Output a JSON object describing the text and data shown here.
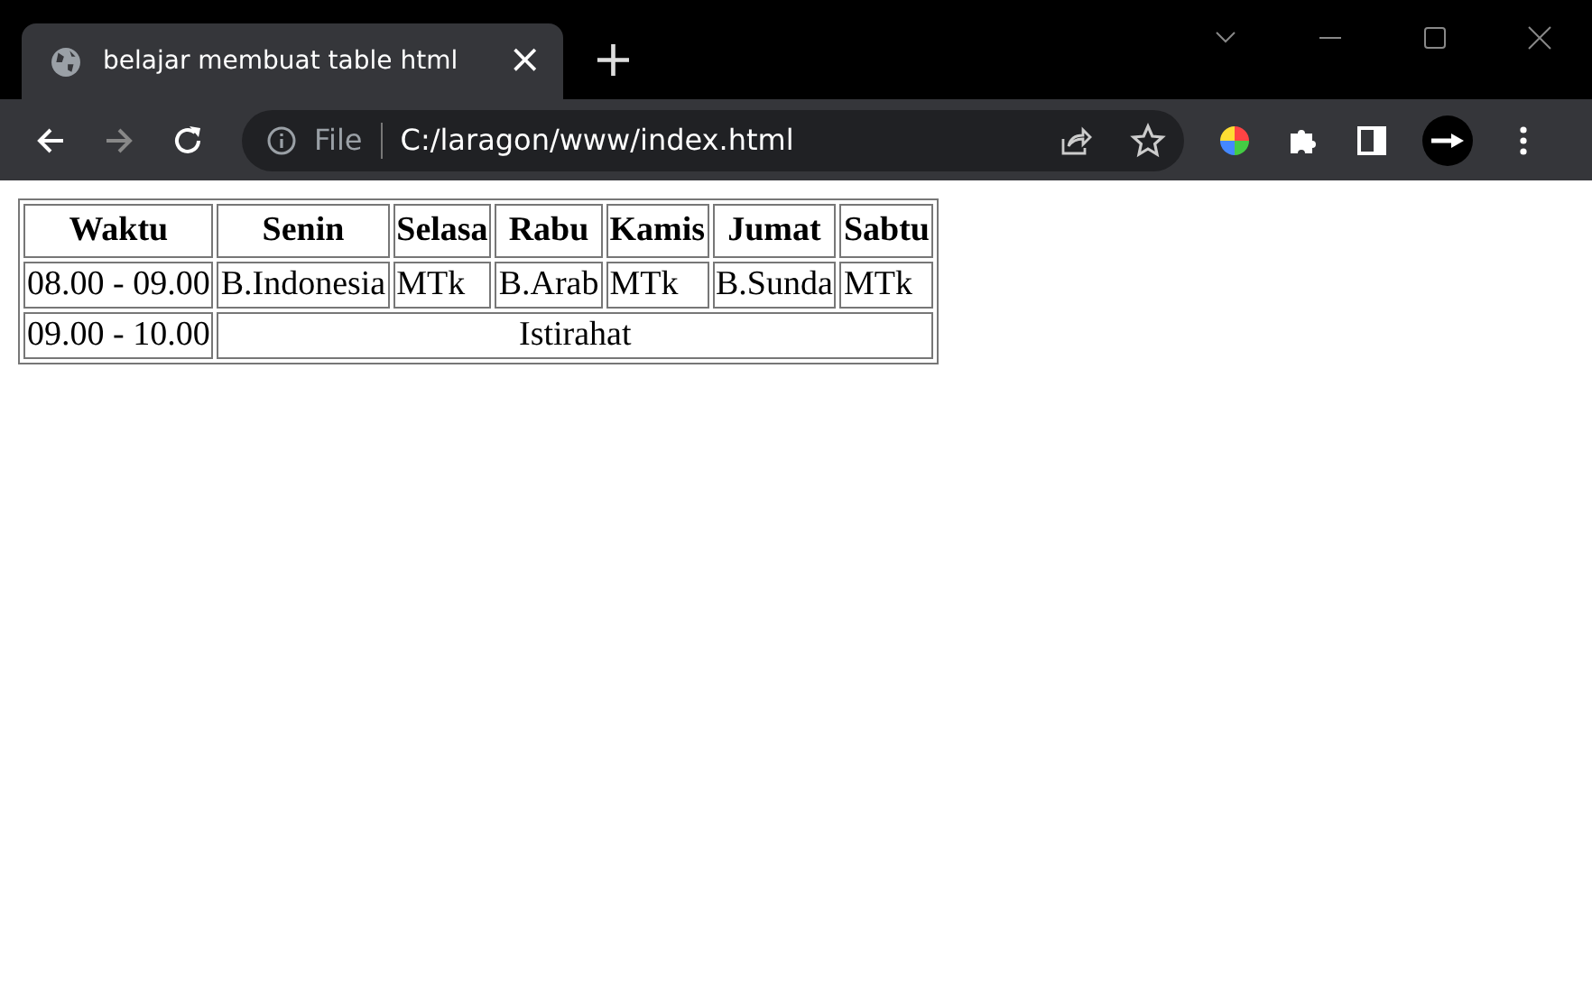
{
  "tab": {
    "title": "belajar membuat table html",
    "close": "×",
    "selected": true
  },
  "new_tab": "+",
  "address_bar": {
    "scheme": "File",
    "url": "C:/laragon/www/index.html"
  },
  "table": {
    "columns": [
      "Waktu",
      "Senin",
      "Selasa",
      "Rabu",
      "Kamis",
      "Jumat",
      "Sabtu"
    ],
    "rows": [
      [
        {
          "text": "08.00 - 09.00",
          "kind": "cell"
        },
        {
          "text": "B.Indonesia",
          "kind": "cell"
        },
        {
          "text": "MTk",
          "kind": "cell"
        },
        {
          "text": "B.Arab",
          "kind": "cell"
        },
        {
          "text": "MTk",
          "kind": "cell"
        },
        {
          "text": "B.Sunda",
          "kind": "cell"
        },
        {
          "text": "MTk",
          "kind": "cell"
        }
      ],
      [
        {
          "text": "09.00 - 10.00",
          "kind": "cell"
        },
        {
          "text": "Istirahat",
          "kind": "merged",
          "colspan": 6
        }
      ]
    ]
  }
}
